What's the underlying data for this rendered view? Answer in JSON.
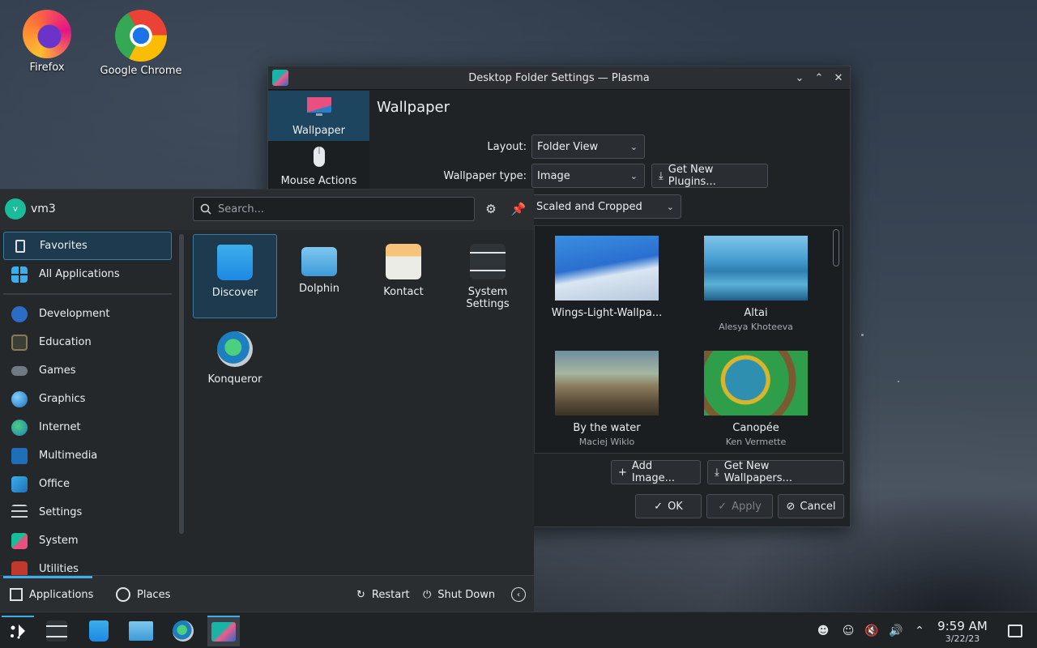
{
  "desktop": {
    "icons": [
      {
        "label": "Firefox"
      },
      {
        "label": "Google Chrome"
      }
    ]
  },
  "dialog": {
    "title": "Desktop Folder Settings — Plasma",
    "categories": [
      {
        "label": "Wallpaper"
      },
      {
        "label": "Mouse Actions"
      }
    ],
    "heading": "Wallpaper",
    "layout_label": "Layout:",
    "layout_value": "Folder View",
    "wallpaper_type_label": "Wallpaper type:",
    "wallpaper_type_value": "Image",
    "get_plugins_label": "Get New Plugins...",
    "positioning_value": "Scaled and Cropped",
    "wallpapers": [
      {
        "name": "Wings-Light-Wallpa...",
        "author": ""
      },
      {
        "name": "Altai",
        "author": "Alesya Khoteeva"
      },
      {
        "name": "By the water",
        "author": "Maciej Wiklo"
      },
      {
        "name": "Canopée",
        "author": "Ken Vermette"
      }
    ],
    "add_image_label": "Add Image...",
    "get_wallpapers_label": "Get New Wallpapers...",
    "ok_label": "OK",
    "apply_label": "Apply",
    "cancel_label": "Cancel"
  },
  "launcher": {
    "avatar_initial": "v",
    "username": "vm3",
    "search_placeholder": "Search...",
    "categories": [
      {
        "label": "Favorites"
      },
      {
        "label": "All Applications"
      },
      {
        "label": "Development"
      },
      {
        "label": "Education"
      },
      {
        "label": "Games"
      },
      {
        "label": "Graphics"
      },
      {
        "label": "Internet"
      },
      {
        "label": "Multimedia"
      },
      {
        "label": "Office"
      },
      {
        "label": "Settings"
      },
      {
        "label": "System"
      },
      {
        "label": "Utilities"
      }
    ],
    "apps": [
      {
        "label": "Discover"
      },
      {
        "label": "Dolphin"
      },
      {
        "label": "Kontact"
      },
      {
        "label": "System Settings"
      },
      {
        "label": "Konqueror"
      }
    ],
    "footer": {
      "applications_label": "Applications",
      "places_label": "Places",
      "restart_label": "Restart",
      "shutdown_label": "Shut Down"
    }
  },
  "taskbar": {
    "time": "9:59 AM",
    "date": "3/22/23"
  },
  "colors": {
    "accent": "#3daee9",
    "selection": "#1d3a4e"
  }
}
